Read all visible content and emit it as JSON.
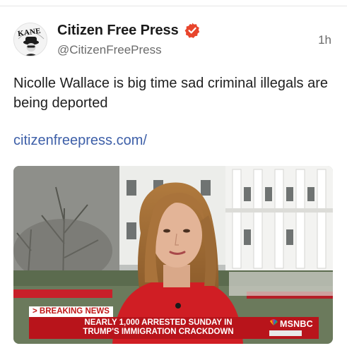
{
  "post": {
    "author": {
      "display_name": "Citizen Free Press",
      "handle": "@CitizenFreePress",
      "verified": true,
      "avatar_text": "KANE"
    },
    "timestamp": "1h",
    "text": "Nicolle Wallace is big time sad criminal illegals are being deported",
    "link": "citizenfreepress.com/",
    "media": {
      "breaking_label": "> BREAKING NEWS",
      "headline_line1": "NEARLY 1,000 ARRESTED SUNDAY IN",
      "headline_line2": "TRUMP'S IMMIGRATION CRACKDOWN",
      "network": "MSNBC"
    }
  },
  "colors": {
    "verified_badge": "#e8452c",
    "link": "#3d5fa8",
    "chyron_red": "#b8141b"
  },
  "icons": [
    "verified-badge-icon",
    "peacock-icon"
  ]
}
